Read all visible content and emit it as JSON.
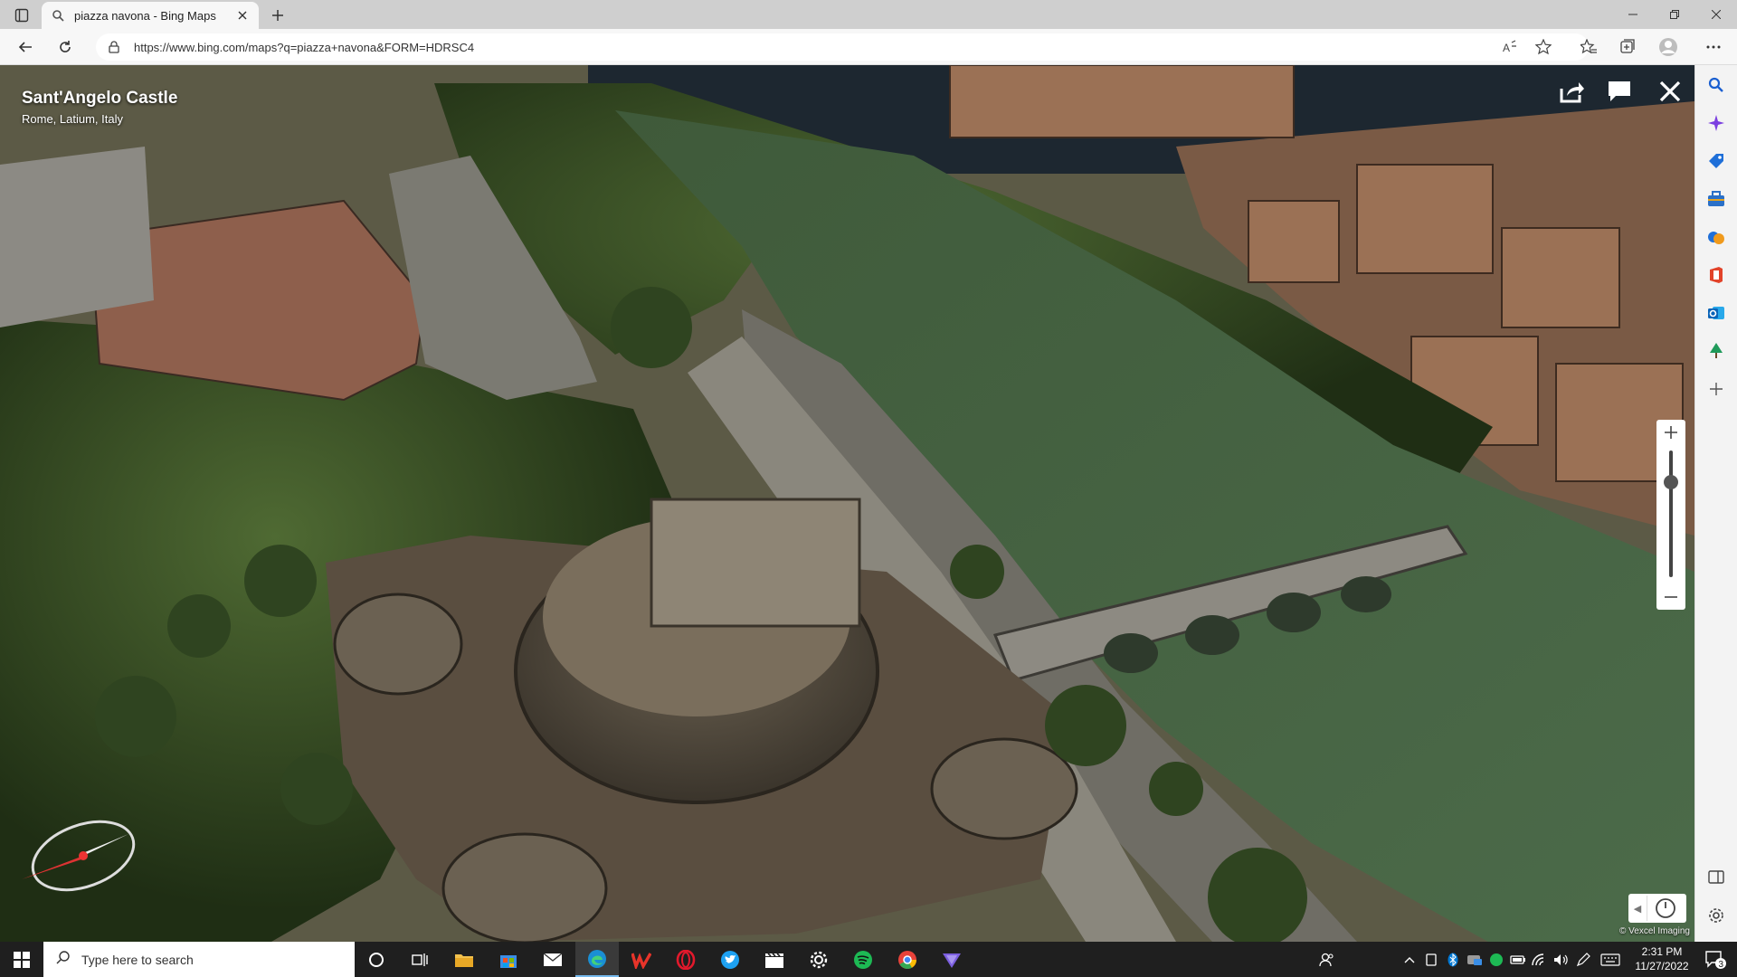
{
  "browser": {
    "tab_title": "piazza navona - Bing Maps",
    "url": "https://www.bing.com/maps?q=piazza+navona&FORM=HDRSC4",
    "accent": "#0078d4"
  },
  "map": {
    "place_title": "Sant'Angelo Castle",
    "place_subtitle": "Rome, Latium, Italy",
    "copyright": "© Vexcel Imaging",
    "top_buttons": [
      "share-icon",
      "feedback-icon",
      "close-icon"
    ],
    "zoom_level": 0.75
  },
  "sidebar": {
    "icons": [
      "search-icon",
      "copilot-icon",
      "shopping-tag-icon",
      "tools-icon",
      "games-icon",
      "office-icon",
      "outlook-icon",
      "tree-icon",
      "add-icon",
      "split-screen-icon",
      "settings-icon"
    ]
  },
  "taskbar": {
    "search_placeholder": "Type here to search",
    "apps": [
      "cortana-icon",
      "task-view-icon",
      "file-explorer-icon",
      "store-icon",
      "mail-icon",
      "edge-icon",
      "wps-icon",
      "opera-icon",
      "twitter-icon",
      "clapper-icon",
      "settings-icon",
      "spotify-icon",
      "chrome-icon",
      "protonvpn-icon"
    ],
    "time": "2:31 PM",
    "date": "11/27/2022",
    "notification_count": "3"
  }
}
